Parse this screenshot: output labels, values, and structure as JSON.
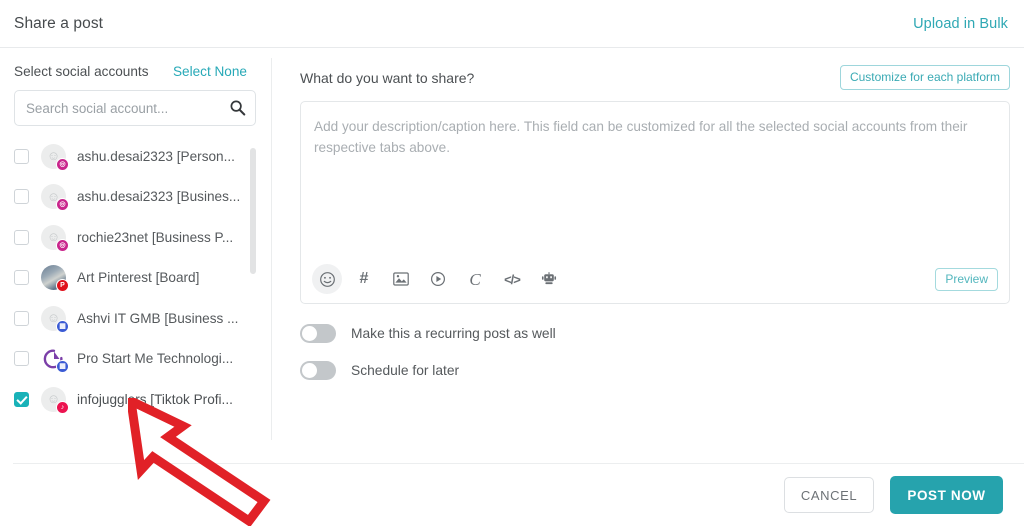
{
  "header": {
    "title": "Share a post",
    "upload_bulk_label": "Upload in Bulk"
  },
  "left_panel": {
    "section_label": "Select social accounts",
    "select_none_label": "Select None",
    "search": {
      "placeholder": "Search social account...",
      "value": "",
      "icon": "search-icon"
    },
    "accounts": [
      {
        "label": "ashu.desai2323 [Person...",
        "network": "instagram",
        "checked": false
      },
      {
        "label": "ashu.desai2323 [Busines...",
        "network": "instagram",
        "checked": false
      },
      {
        "label": "rochie23net [Business P...",
        "network": "instagram",
        "checked": false
      },
      {
        "label": "Art Pinterest [Board]",
        "network": "pinterest",
        "checked": false
      },
      {
        "label": "Ashvi IT GMB [Business ...",
        "network": "gmb",
        "checked": false
      },
      {
        "label": "Pro Start Me Technologi...",
        "network": "gmb",
        "checked": false
      },
      {
        "label": "infojugglers [Tiktok Profi...",
        "network": "tiktok",
        "checked": true
      }
    ]
  },
  "right_panel": {
    "section_label": "What do you want to share?",
    "customize_label": "Customize for each platform",
    "editor": {
      "placeholder": "Add your description/caption here. This field can be customized for all the selected social accounts from their respective tabs above.",
      "value": "",
      "preview_label": "Preview",
      "toolbar": [
        {
          "name": "emoji-icon",
          "glyph": "☺",
          "active": true
        },
        {
          "name": "hashtag-icon",
          "glyph": "#",
          "active": false
        },
        {
          "name": "image-icon",
          "glyph": "ὛC",
          "active": false
        },
        {
          "name": "video-icon",
          "glyph": "▶",
          "active": false
        },
        {
          "name": "curve-text-icon",
          "glyph": "C",
          "active": false
        },
        {
          "name": "code-icon",
          "glyph": "</>",
          "active": false
        },
        {
          "name": "ai-robot-icon",
          "glyph": "ᾑ6",
          "active": false
        }
      ]
    },
    "toggles": [
      {
        "label": "Make this a recurring post as well",
        "on": false
      },
      {
        "label": "Schedule for later",
        "on": false
      }
    ]
  },
  "footer": {
    "cancel_label": "CANCEL",
    "post_now_label": "POST NOW"
  },
  "annotation": {
    "type": "red-arrow",
    "points_to": "infojugglers [Tiktok Profi...",
    "color": "#e12127"
  },
  "colors": {
    "accent_teal": "#26a3ad",
    "link_teal": "#2fa8b4",
    "text_primary": "#4c5053",
    "text_secondary": "#55595c",
    "placeholder": "#a9aeb2",
    "border": "#e4e7e9",
    "annotation_red": "#e12127"
  }
}
